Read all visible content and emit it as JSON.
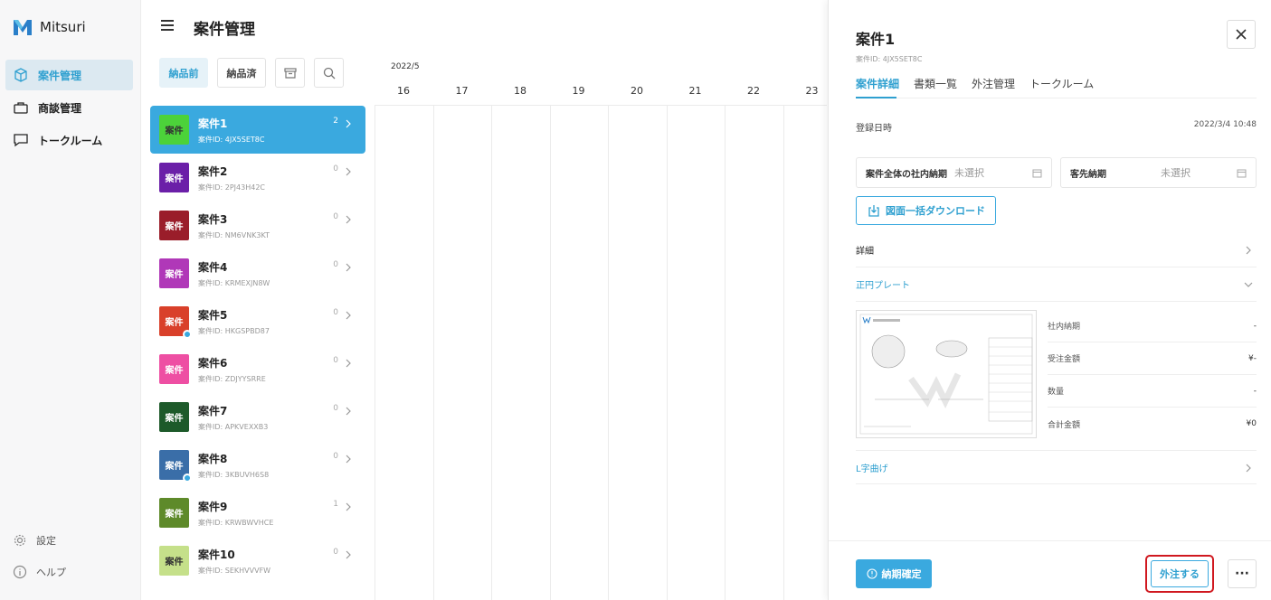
{
  "app": {
    "name": "Mitsuri"
  },
  "sidebar": {
    "items": [
      {
        "label": "案件管理",
        "icon": "cube-icon",
        "active": true
      },
      {
        "label": "商談管理",
        "icon": "briefcase-icon",
        "active": false
      },
      {
        "label": "トークルーム",
        "icon": "chat-icon",
        "active": false
      }
    ],
    "footer": [
      {
        "label": "設定",
        "icon": "gear-icon"
      },
      {
        "label": "ヘルプ",
        "icon": "info-icon"
      }
    ]
  },
  "header": {
    "title": "案件管理"
  },
  "toolbar": {
    "before_label": "納品前",
    "after_label": "納品済"
  },
  "cases": [
    {
      "thumb": "案件",
      "name": "案件1",
      "id": "案件ID: 4JX5SET8C",
      "count": "2",
      "color": "#4cd23a",
      "dot": false
    },
    {
      "thumb": "案件",
      "name": "案件2",
      "id": "案件ID: 2PJ43H42C",
      "count": "0",
      "color": "#6b1fa8",
      "dot": false
    },
    {
      "thumb": "案件",
      "name": "案件3",
      "id": "案件ID: NM6VNK3KT",
      "count": "0",
      "color": "#9a1d2a",
      "dot": false
    },
    {
      "thumb": "案件",
      "name": "案件4",
      "id": "案件ID: KRMEXJN8W",
      "count": "0",
      "color": "#b038b8",
      "dot": false
    },
    {
      "thumb": "案件",
      "name": "案件5",
      "id": "案件ID: HKGSPBD87",
      "count": "0",
      "color": "#d9402a",
      "dot": true
    },
    {
      "thumb": "案件",
      "name": "案件6",
      "id": "案件ID: ZDJYYSRRE",
      "count": "0",
      "color": "#ee4fa3",
      "dot": false
    },
    {
      "thumb": "案件",
      "name": "案件7",
      "id": "案件ID: APKVEXXB3",
      "count": "0",
      "color": "#1d5a2a",
      "dot": false
    },
    {
      "thumb": "案件",
      "name": "案件8",
      "id": "案件ID: 3KBUVH6S8",
      "count": "0",
      "color": "#3a6ea8",
      "dot": true
    },
    {
      "thumb": "案件",
      "name": "案件9",
      "id": "案件ID: KRWBWVHCE",
      "count": "1",
      "color": "#5e8a2a",
      "dot": false
    },
    {
      "thumb": "案件",
      "name": "案件10",
      "id": "案件ID: SEKHVVVFW",
      "count": "0",
      "color": "#c5e08a",
      "dot": false
    }
  ],
  "calendar": {
    "month": "2022/5",
    "days": [
      "16",
      "17",
      "18",
      "19",
      "20",
      "21",
      "22",
      "23"
    ]
  },
  "panel": {
    "title": "案件1",
    "subtitle": "案件ID: 4JX5SET8C",
    "tabs": [
      "案件詳細",
      "書類一覧",
      "外注管理",
      "トークルーム"
    ],
    "registered_label": "登録日時",
    "registered_value": "2022/3/4 10:48",
    "internal_deadline_label": "案件全体の社内納期",
    "internal_deadline_value": "未選択",
    "client_deadline_label": "客先納期",
    "client_deadline_value": "未選択",
    "download_label": "図面一括ダウンロード",
    "detail_label": "詳細",
    "part1_label": "正円プレート",
    "specs": [
      {
        "label": "社内納期",
        "value": "-"
      },
      {
        "label": "受注金額",
        "value": "¥-"
      },
      {
        "label": "数量",
        "value": "-"
      },
      {
        "label": "合計金額",
        "value": "¥0"
      }
    ],
    "part2_label": "L字曲げ",
    "confirm_label": "納期確定",
    "order_label": "外注する",
    "more_label": "···"
  }
}
